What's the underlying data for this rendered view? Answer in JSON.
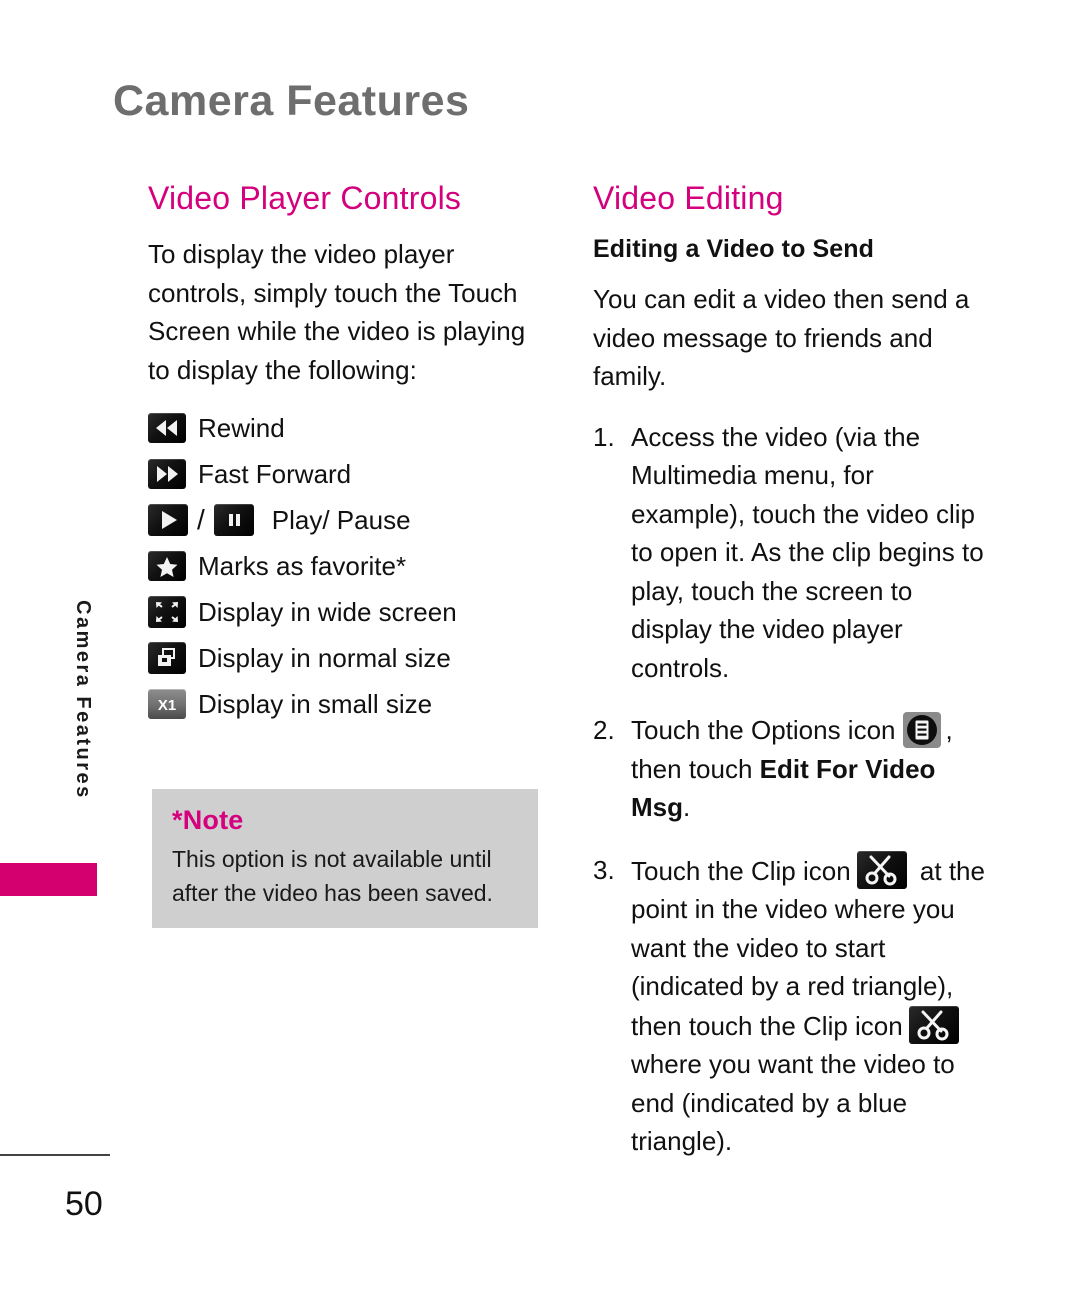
{
  "header": {
    "title": "Camera Features"
  },
  "side_tab": {
    "label": "Camera Features"
  },
  "left_column": {
    "section_title": "Video Player Controls",
    "intro": "To display the video player controls, simply touch the Touch Screen while the video is playing to display the following:",
    "controls": [
      {
        "icon": "rewind-icon",
        "label": "Rewind"
      },
      {
        "icon": "fast-forward-icon",
        "label": "Fast Forward"
      },
      {
        "icon": "play-pause-icon",
        "label": "Play/ Pause",
        "separator": "/"
      },
      {
        "icon": "star-favorite-icon",
        "label": "Marks as favorite*"
      },
      {
        "icon": "wide-screen-icon",
        "label": "Display in wide screen"
      },
      {
        "icon": "normal-size-icon",
        "label": "Display in normal size"
      },
      {
        "icon": "small-size-icon",
        "label": "Display in small size"
      }
    ],
    "note": {
      "title": "*Note",
      "body": "This option is not available until after the video has been saved."
    }
  },
  "right_column": {
    "section_title": "Video Editing",
    "sub_title": "Editing a Video to Send",
    "intro": "You can edit a video then send a video message to friends and family.",
    "steps": [
      {
        "marker": "1.",
        "text_1": "Access the video (via the Multimedia menu, for example), touch the video clip to open it. As the clip begins to play, touch the screen to display the video player controls.",
        "text_2": "",
        "text_3": ""
      },
      {
        "marker": "2.",
        "text_1": "Touch the Options icon",
        "text_2": ", then touch ",
        "bold_1": "Edit For Video Msg",
        "text_3": "."
      },
      {
        "marker": "3.",
        "text_1": "Touch the Clip icon",
        "text_2": " at the point in the video where you want the video to start (indicated by a red triangle), then touch the Clip icon",
        "text_3": " where you want the video to end (indicated by a blue triangle)."
      }
    ]
  },
  "footer": {
    "page_number": "50"
  },
  "colors": {
    "accent": "#d4007d",
    "header_gray": "#6e6e6e",
    "note_bg": "#cfcfcf",
    "tab": "#d4006f",
    "text": "#111111"
  }
}
